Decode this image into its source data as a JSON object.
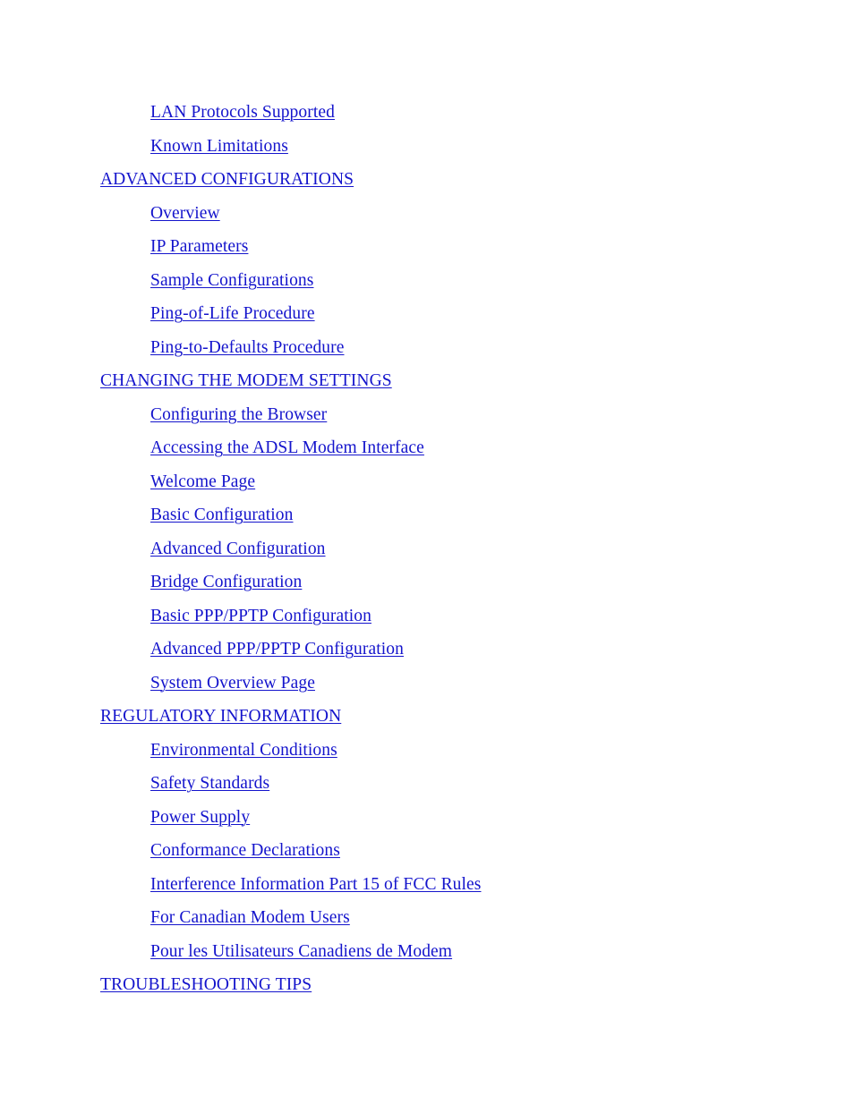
{
  "document": {
    "type": "table-of-contents",
    "background_color": "#ffffff",
    "link_color": "#1414cc"
  },
  "toc": {
    "entries": [
      {
        "label": "LAN Protocols Supported",
        "level": 2
      },
      {
        "label": "Known Limitations",
        "level": 2
      },
      {
        "label": "ADVANCED CONFIGURATIONS",
        "level": 1
      },
      {
        "label": "Overview",
        "level": 2
      },
      {
        "label": "IP Parameters",
        "level": 2
      },
      {
        "label": "Sample Configurations",
        "level": 2
      },
      {
        "label": "Ping-of-Life Procedure",
        "level": 2
      },
      {
        "label": "Ping-to-Defaults Procedure",
        "level": 2
      },
      {
        "label": "CHANGING THE MODEM SETTINGS",
        "level": 1
      },
      {
        "label": "Configuring the Browser",
        "level": 2
      },
      {
        "label": "Accessing the ADSL Modem Interface",
        "level": 2
      },
      {
        "label": "Welcome Page",
        "level": 2
      },
      {
        "label": "Basic Configuration",
        "level": 2
      },
      {
        "label": "Advanced Configuration",
        "level": 2
      },
      {
        "label": "Bridge Configuration",
        "level": 2
      },
      {
        "label": "Basic PPP/PPTP Configuration",
        "level": 2
      },
      {
        "label": "Advanced PPP/PPTP Configuration",
        "level": 2
      },
      {
        "label": "System Overview Page",
        "level": 2
      },
      {
        "label": "REGULATORY INFORMATION",
        "level": 1
      },
      {
        "label": "Environmental Conditions",
        "level": 2
      },
      {
        "label": "Safety Standards",
        "level": 2
      },
      {
        "label": "Power Supply",
        "level": 2
      },
      {
        "label": "Conformance Declarations",
        "level": 2
      },
      {
        "label": "Interference Information Part 15 of FCC Rules",
        "level": 2
      },
      {
        "label": "For Canadian Modem Users",
        "level": 2
      },
      {
        "label": "Pour les Utilisateurs Canadiens de Modem",
        "level": 2
      },
      {
        "label": "TROUBLESHOOTING TIPS",
        "level": 1
      }
    ]
  }
}
